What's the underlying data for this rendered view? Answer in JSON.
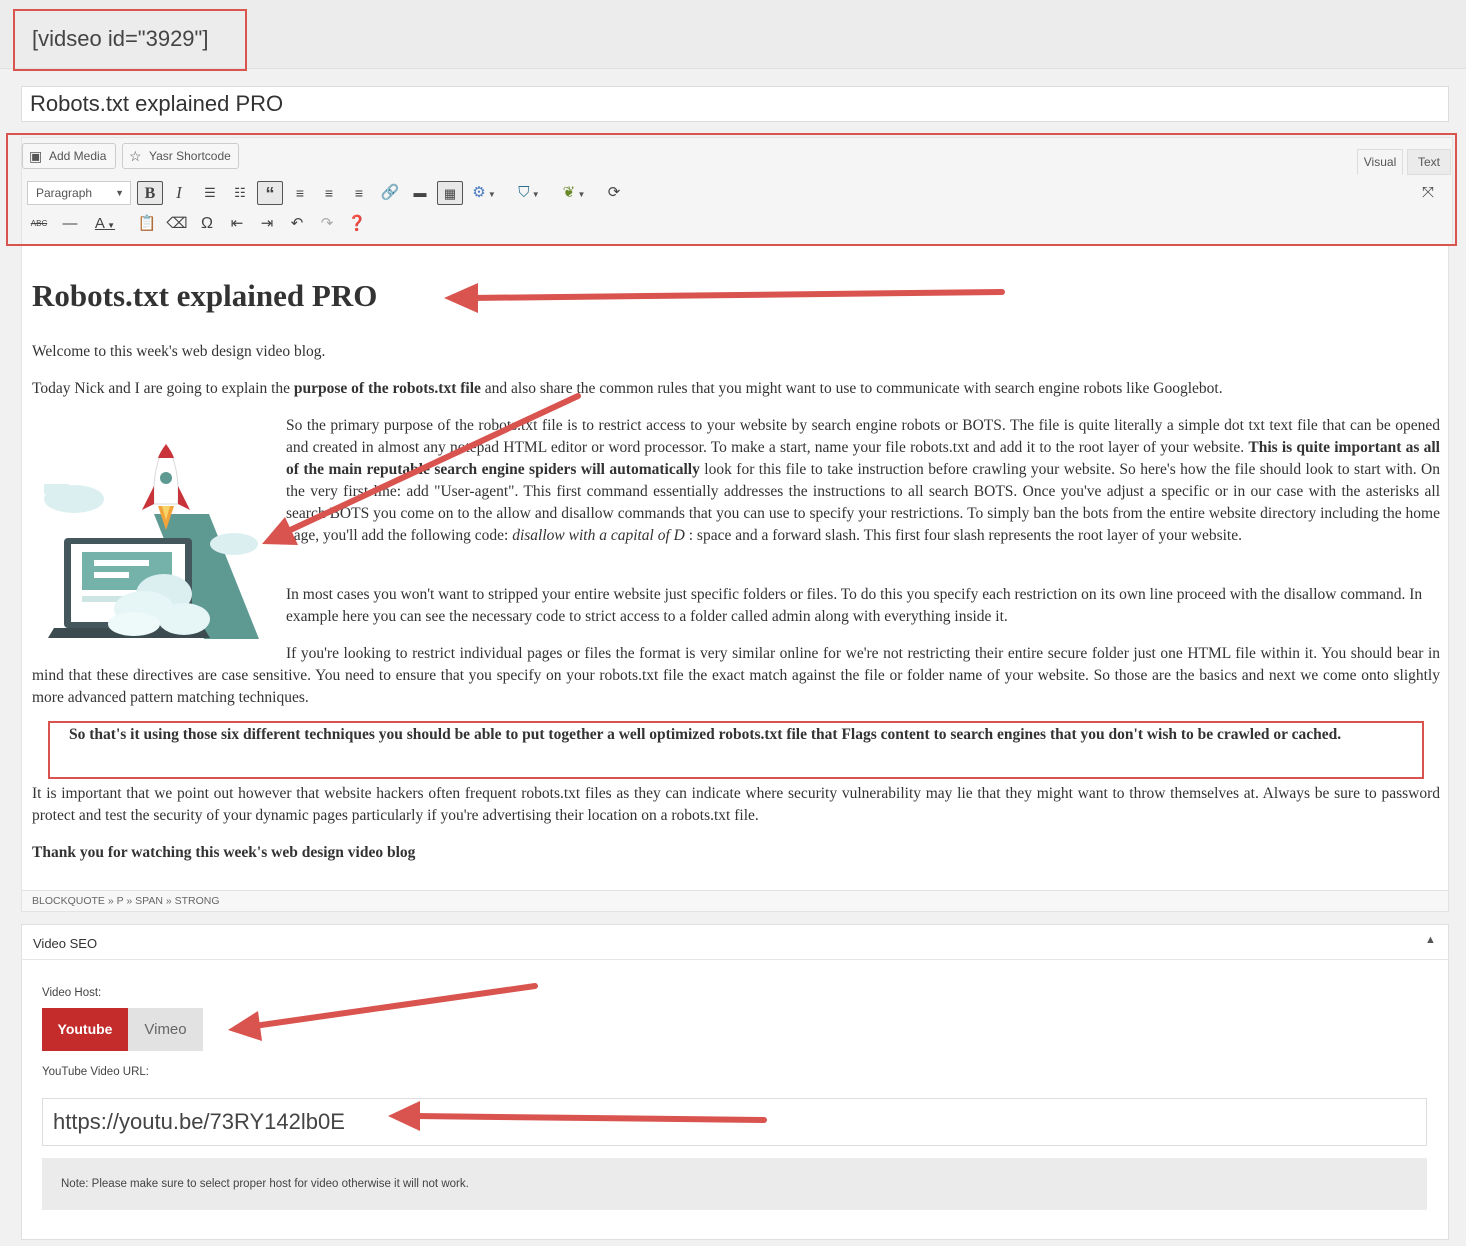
{
  "shortcode": "[vidseo id=\"3929\"]",
  "post_title": "Robots.txt explained PRO",
  "toolbar": {
    "add_media": "Add Media",
    "yasr_shortcode": "Yasr Shortcode",
    "visual_tab": "Visual",
    "text_tab": "Text",
    "format_select": "Paragraph"
  },
  "content": {
    "heading": "Robots.txt explained PRO",
    "p1": "Welcome to this week's web design video blog.",
    "p2_a": "Today Nick and I are going to explain the ",
    "p2_b": "purpose of the robots.txt file",
    "p2_c": " and also share the common rules that you might want to use to communicate with search engine robots like Googlebot.",
    "p3_a": "So the primary purpose of the robots.txt file is to restrict access to your website by search engine robots or BOTS. The file is quite literally a simple dot txt text file that can be opened and created in almost any notepad HTML editor or word processor. To make a start, name your file robots.txt and add it to the root layer of your website. ",
    "p3_b": "This is quite important as all of the main reputable search engine spiders will automatically",
    "p3_c": " look for this file to take instruction before crawling your website. So here's how the file should look to start with. On the very first line: add \"User-agent\". This first command essentially addresses the instructions to all search BOTS. Once you've adjust a specific or in our case with the asterisks all search BOTS you come on to the allow and disallow commands that you can use to specify your restrictions. To simply ban the bots from the entire website directory including the home page, you'll add the following code: ",
    "p3_d": "disallow with a capital of D",
    "p3_e": " : space and a forward slash. This first four slash represents the root layer of your website.",
    "p4": "In most cases you won't want to stripped your entire website just specific folders or files. To do this you specify each restriction on its own line proceed with the disallow command. In example here you can see the necessary code to strict access to a folder called admin along with everything inside it.",
    "p5": "If you're looking to restrict individual pages or files the format is very similar online for we're not restricting their entire secure folder just one HTML file within it. You should bear in mind that these directives are case sensitive. You need to ensure that you specify on your robots.txt file the exact match against the file or folder name of your website. So those are the basics and next we come onto slightly more advanced pattern matching techniques.",
    "blockquote": "So that's it using those six different techniques you should be able to put together a well optimized robots.txt file that Flags content to search engines that you don't wish to be crawled or cached.",
    "p6": "It is important that we point out however that website hackers often frequent robots.txt files as they can indicate where security vulnerability may lie that they might want to throw themselves at. Always be sure to password protect and test the security of your dynamic pages particularly if you're advertising their location on a robots.txt file.",
    "p7": "Thank you for watching this week's web design video blog"
  },
  "statusbar": "BLOCKQUOTE » P » SPAN » STRONG",
  "video_seo": {
    "title": "Video SEO",
    "host_label": "Video Host:",
    "host_options": [
      "Youtube",
      "Vimeo"
    ],
    "selected_host": "Youtube",
    "url_label": "YouTube Video URL:",
    "url_value": "https://youtu.be/73RY142lb0E",
    "note": "Note: Please make sure to select proper host for video otherwise it will not work."
  },
  "colors": {
    "annotation_red": "#d9534f",
    "youtube_red": "#c42b2b"
  },
  "icons": [
    "image-icon",
    "star-icon",
    "bold-icon",
    "italic-icon",
    "bullet-list-icon",
    "numbered-list-icon",
    "blockquote-icon",
    "align-left-icon",
    "align-center-icon",
    "align-right-icon",
    "link-icon",
    "more-tag-icon",
    "toolbar-toggle-icon",
    "plugin-gear-icon",
    "shield-icon",
    "plugin-leaf-icon",
    "refresh-icon",
    "fullscreen-icon",
    "strikethrough-icon",
    "horizontal-line-icon",
    "text-color-icon",
    "paste-text-icon",
    "clear-format-icon",
    "special-char-icon",
    "outdent-icon",
    "indent-icon",
    "undo-icon",
    "redo-icon",
    "help-icon",
    "rocket-laptop-illustration",
    "collapse-arrow-icon"
  ]
}
